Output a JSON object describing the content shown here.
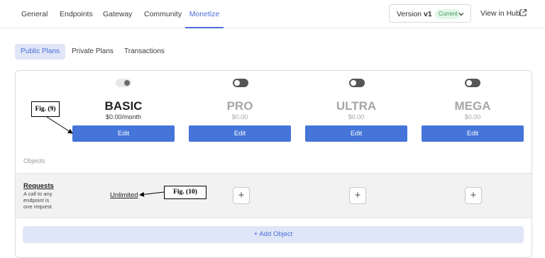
{
  "nav": {
    "tabs": [
      {
        "label": "General"
      },
      {
        "label": "Endpoints"
      },
      {
        "label": "Gateway"
      },
      {
        "label": "Community"
      },
      {
        "label": "Monetize"
      }
    ],
    "active_tab": "Monetize",
    "version": {
      "prefix": "Version",
      "value": "v1",
      "badge": "Current"
    },
    "view_hub": "View in Hub"
  },
  "subtabs": [
    {
      "label": "Public Plans"
    },
    {
      "label": "Private Plans"
    },
    {
      "label": "Transactions"
    }
  ],
  "plans": [
    {
      "name": "BASIC",
      "price": "$0.00/month",
      "edit": "Edit",
      "enabled": true
    },
    {
      "name": "PRO",
      "price": "$0.00",
      "edit": "Edit",
      "enabled": false
    },
    {
      "name": "ULTRA",
      "price": "$0.00",
      "edit": "Edit",
      "enabled": false
    },
    {
      "name": "MEGA",
      "price": "$0.00",
      "edit": "Edit",
      "enabled": false
    }
  ],
  "objects": {
    "label": "Objects",
    "requests": {
      "title": "Requests",
      "description": "A call to any endpoint is one request.",
      "basic_value": "Unlimited",
      "add_symbol": "+"
    },
    "add_object": "+ Add Object"
  },
  "annotations": {
    "fig9": "Fig. (9)",
    "fig10": "Fig. (10)"
  },
  "colors": {
    "accent": "#4a6cd8",
    "edit_button": "#4575d9",
    "current_badge": "#3d9b57"
  }
}
